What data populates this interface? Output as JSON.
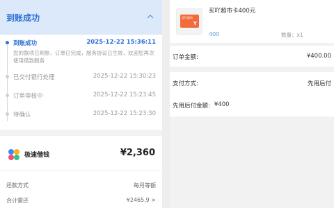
{
  "left_panel": {
    "status_header": {
      "title": "到账成功",
      "chevron_icon": "chevron-up-icon"
    },
    "timeline": [
      {
        "label": "到账成功",
        "time": "2025-12-22 15:36:11",
        "active": true
      },
      {
        "label": "已交付银行处理",
        "time": "2025-12-22 15:30:23",
        "active": false
      },
      {
        "label": "订单审核中",
        "time": "2025-12-22 15:23:45",
        "active": false
      },
      {
        "label": "待确认",
        "time": "2025-12-22 15:23:30",
        "active": false
      }
    ],
    "timeline_desc": "您的款项已到账，订单已完成，服务协议已生效，欢迎您再次使用借款服务",
    "loan_card": {
      "logo_icon": "petal-logo-icon",
      "name": "极速借钱",
      "amount": "¥2,360",
      "rows": [
        {
          "label": "还款方式",
          "value": "每月等额"
        },
        {
          "label": "合计需还",
          "value": "¥2465.9 >"
        }
      ]
    }
  },
  "right_panel": {
    "product": {
      "title": "买吖超市卡400元",
      "card_text": "买吖超市",
      "card_mark": "Y",
      "price": "400",
      "qty": "数量：x1"
    },
    "order_total": {
      "label": "订单金额:",
      "value": "¥400.00"
    },
    "payment": {
      "method_label": "支付方式:",
      "method_value": "先用后付",
      "amount_label": "先用后付金额:",
      "amount_value": "¥400"
    }
  },
  "colors": {
    "accent": "#2f72d6",
    "header_bg": "#dce9fb",
    "price_blue": "#5b9bd5",
    "card_orange": "#f26b3a"
  }
}
